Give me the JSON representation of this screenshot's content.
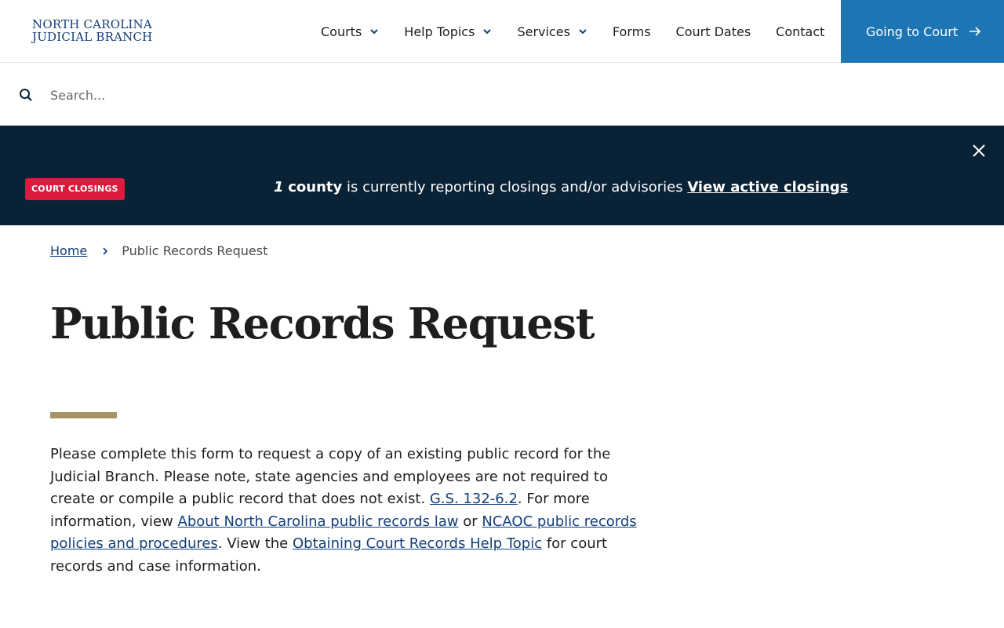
{
  "header": {
    "logo_line1": "NORTH CAROLINA",
    "logo_line2": "JUDICIAL BRANCH",
    "nav": [
      {
        "label": "Courts",
        "dropdown": true
      },
      {
        "label": "Help Topics",
        "dropdown": true
      },
      {
        "label": "Services",
        "dropdown": true
      },
      {
        "label": "Forms",
        "dropdown": false
      },
      {
        "label": "Court Dates",
        "dropdown": false
      },
      {
        "label": "Contact",
        "dropdown": false
      }
    ],
    "cta_label": "Going to Court",
    "cta_color": "#1d75b4"
  },
  "search": {
    "placeholder": "Search...",
    "value": ""
  },
  "alert": {
    "badge": "COURT CLOSINGS",
    "badge_color": "#dc1b3e",
    "count": "1",
    "count_unit": "county",
    "message": " is currently reporting closings and/or advisories ",
    "link": "View active closings",
    "background": "#0a2236"
  },
  "breadcrumb": {
    "home": "Home",
    "current": "Public Records Request"
  },
  "page": {
    "title": "Public Records Request",
    "accent_color": "#a89366",
    "body": {
      "t1": "Please complete this form to request a copy of an existing public record for the Judicial Branch. Please note, state agencies and employees are not required to create or compile a public record that does not exist. ",
      "link1": "G.S. 132-6.2",
      "t2": ". For more information, view ",
      "link2": "About North Carolina public records law",
      "t3": " or ",
      "link3": "NCAOC public records policies and procedures",
      "t4": ". View the ",
      "link4": "Obtaining Court Records Help Topic",
      "t5": " for court records and case information."
    }
  }
}
